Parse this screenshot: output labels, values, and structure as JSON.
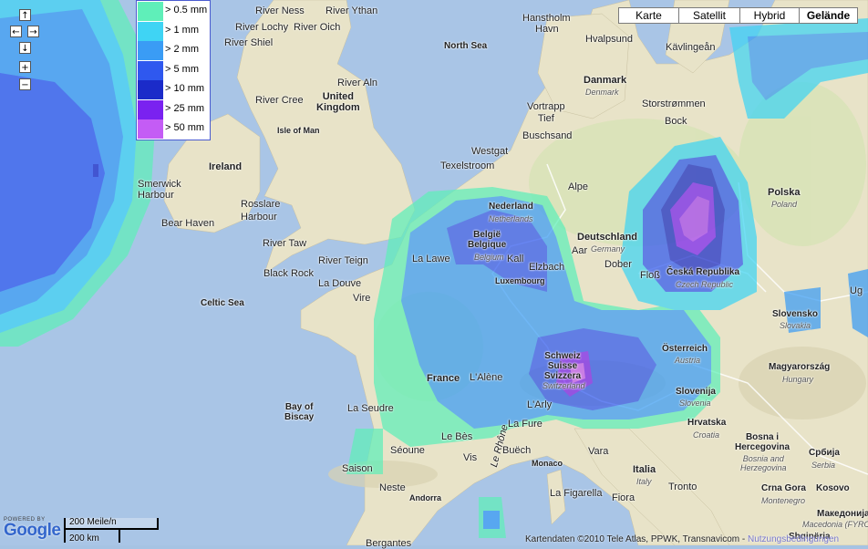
{
  "map_type_buttons": [
    {
      "label": "Karte",
      "active": false
    },
    {
      "label": "Satellit",
      "active": false
    },
    {
      "label": "Hybrid",
      "active": false
    },
    {
      "label": "Gelände",
      "active": true
    }
  ],
  "legend": [
    {
      "label": "> 0.5 mm",
      "color": "#5fefb9"
    },
    {
      "label": "> 1 mm",
      "color": "#3fd4f4"
    },
    {
      "label": "> 2 mm",
      "color": "#3a9cf5"
    },
    {
      "label": "> 5 mm",
      "color": "#2f58ef"
    },
    {
      "label": "> 10 mm",
      "color": "#1b2bc9"
    },
    {
      "label": "> 25 mm",
      "color": "#7a22f0"
    },
    {
      "label": "> 50 mm",
      "color": "#c45cf5"
    }
  ],
  "nav": {
    "up": "↑",
    "left": "←",
    "right": "→",
    "down": "↓",
    "zoom_in": "+",
    "zoom_out": "−"
  },
  "scale": {
    "miles": "200 Meile/n",
    "km": "200 km"
  },
  "logo": {
    "powered_by": "POWERED BY",
    "name": "Google"
  },
  "attribution": {
    "text": "Kartendaten ©2010 Tele Atlas, PPWK, Transnavicom -",
    "terms": "Nutzungsbedingungen"
  },
  "labels": {
    "river_ness": "River Ness",
    "river_ythan": "River Ythan",
    "river_lochy": "River Lochy",
    "river_oich": "River Oich",
    "river_shiel": "River Shiel",
    "north_sea": "North Sea",
    "hanstholm": "Hanstholm",
    "havn": "Havn",
    "hvalpsund": "Hvalpsund",
    "kavlinge": "Kävlingeån",
    "river_aln": "River Aln",
    "river_cree": "River Cree",
    "united_kingdom": "United\nKingdom",
    "isle_of_man": "Isle of Man",
    "denmark": "Danmark",
    "denmark_en": "Denmark",
    "vortrapp": "Vortrapp\nTief",
    "storstrommen": "Storstrømmen",
    "bock": "Bock",
    "buschsand": "Buschsand",
    "ireland": "Ireland",
    "westgat": "Westgat",
    "texelstroom": "Texelstroom",
    "smerwick": "Smerwick\nHarbour",
    "rosslare": "Rosslare\nHarbour",
    "bear_haven": "Bear Haven",
    "alpe": "Alpe",
    "polska": "Polska",
    "poland": "Poland",
    "nederland": "Nederland",
    "netherlands": "Netherlands",
    "river_taw": "River Taw",
    "river_teign": "River Teign",
    "deutschland": "Deutschland",
    "germany": "Germany",
    "aar": "Aar",
    "belgie": "België\nBelgique",
    "belgium": "Belgium",
    "la_lawe": "La Lawe",
    "kall": "Kall",
    "elzbach": "Elzbach",
    "dober": "Dober",
    "black_rock": "Black Rock",
    "la_douve": "La Douve",
    "flos": "Floß",
    "ceska": "Česká Republika",
    "czech": "Czech Republic",
    "luxembourg": "Luxembourg",
    "celtic_sea": "Celtic Sea",
    "vire": "Vire",
    "slovensko": "Slovensko",
    "slovakia": "Slovakia",
    "ug": "Ug",
    "schweiz": "Schweiz\nSuisse\nSvizzera",
    "switzerland": "Switzerland",
    "osterreich": "Österreich",
    "austria": "Austria",
    "france": "France",
    "lalene": "L'Alène",
    "magyarorszag": "Magyarország",
    "hungary": "Hungary",
    "slovenija": "Slovenija",
    "slovenia": "Slovenia",
    "bay_of_biscay": "Bay of\nBiscay",
    "la_seudre": "La Seudre",
    "larly": "L'Arly",
    "hrvatska": "Hrvatska",
    "croatia": "Croatia",
    "bosna": "Bosna i\nHercegovina",
    "bosnia": "Bosnia and\nHerzegovina",
    "srbija": "Србија",
    "serbia": "Serbia",
    "le_bes": "Le Bès",
    "vis": "Vis",
    "la_fure": "La Fure",
    "le_rhone": "Le Rhône",
    "buech": "Buëch",
    "vara": "Vara",
    "monaco": "Monaco",
    "seoune": "Séoune",
    "saison": "Saison",
    "italia": "Italia",
    "italy": "Italy",
    "tronto": "Tronto",
    "neste": "Neste",
    "andorra": "Andorra",
    "la_figarella": "La Figarella",
    "fiora": "Fiora",
    "crna_gora": "Crna Gora",
    "montenegro": "Montenegro",
    "kosovo": "Kosovo",
    "makedonija": "Македонија",
    "macedonia": "Macedonia (FYRO",
    "shqiperia": "Shqipëria",
    "bergantes": "Bergantes"
  }
}
